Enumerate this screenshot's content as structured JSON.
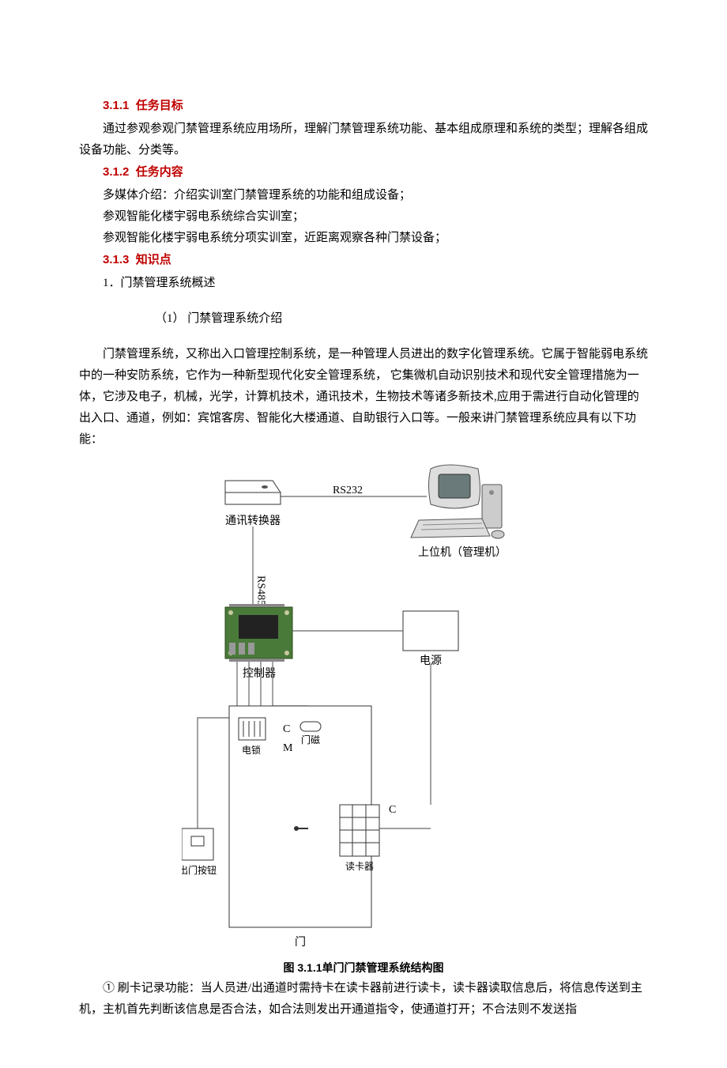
{
  "sections": {
    "s311": {
      "num": "3.1.1",
      "title": "任务目标"
    },
    "s312": {
      "num": "3.1.2",
      "title": "任务内容"
    },
    "s313": {
      "num": "3.1.3",
      "title": "知识点"
    }
  },
  "body": {
    "p311": "通过参观参观门禁管理系统应用场所，理解门禁管理系统功能、基本组成原理和系统的类型；理解各组成设备功能、分类等。",
    "p312_a": "多媒体介绍：介绍实训室门禁管理系统的功能和组成设备；",
    "p312_b": "参观智能化楼宇弱电系统综合实训室；",
    "p312_c": "参观智能化楼宇弱电系统分项实训室，近距离观察各种门禁设备；",
    "s313_item1": "1．门禁管理系统概述",
    "s313_sub1": "（1） 门禁管理系统介绍",
    "p_intro": "门禁管理系统，又称出入口管理控制系统，是一种管理人员进出的数字化管理系统。它属于智能弱电系统中的一种安防系统，它作为一种新型现代化安全管理系统， 它集微机自动识别技术和现代安全管理措施为一体，它涉及电子，机械，光学，计算机技术，通讯技术，生物技术等诸多新技术,应用于需进行自动化管理的出入口、通道，例如：宾馆客房、智能化大楼通道、自助银行入口等。一般来讲门禁管理系统应具有以下功能：",
    "p_func1": "① 刷卡记录功能：当人员进/出通道时需持卡在读卡器前进行读卡，读卡器读取信息后，将信息传送到主机，主机首先判断该信息是否合法，如合法则发出开通道指令，使通道打开；不合法则不发送指"
  },
  "diagram": {
    "rs232": "RS232",
    "rs485": "RS485",
    "converter": "通讯转换器",
    "host": "上位机（管理机）",
    "controller": "控制器",
    "power": "电源",
    "lock": "电锁",
    "doorMag": "门磁",
    "doorMagC": "C",
    "lockM": "M",
    "reader": "读卡器",
    "readerC": "C",
    "exitBtn": "出门按钮",
    "door": "门"
  },
  "figure_caption": "图 3.1.1单门门禁管理系统结构图"
}
